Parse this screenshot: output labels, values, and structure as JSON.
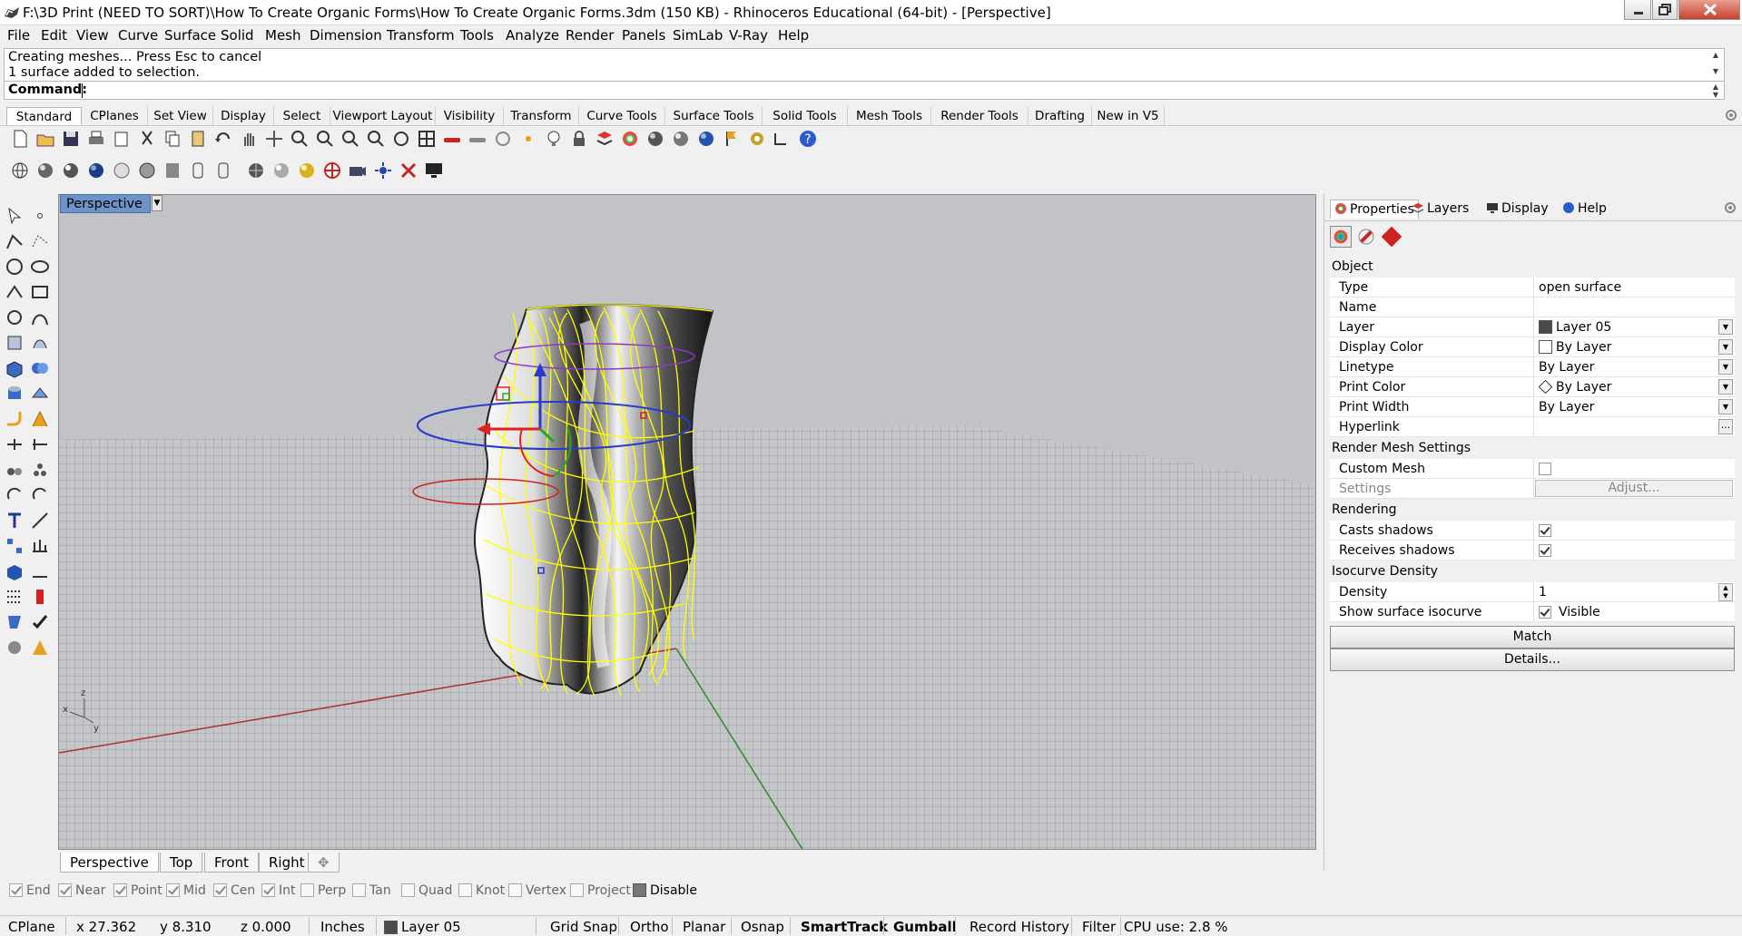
{
  "window": {
    "title": "F:\\3D Print (NEED TO SORT)\\How To Create Organic Forms\\How To Create Organic Forms.3dm (150 KB) - Rhinoceros Educational (64-bit) - [Perspective]"
  },
  "menu": [
    "File",
    "Edit",
    "View",
    "Curve",
    "Surface",
    "Solid",
    "Mesh",
    "Dimension",
    "Transform",
    "Tools",
    "Analyze",
    "Render",
    "Panels",
    "SimLab",
    "V-Ray",
    "Help"
  ],
  "command": {
    "history": [
      "Creating meshes... Press Esc to cancel",
      "1 surface added to selection."
    ],
    "prompt_label": "Command:"
  },
  "toolbar_tabs": [
    "Standard",
    "CPlanes",
    "Set View",
    "Display",
    "Select",
    "Viewport Layout",
    "Visibility",
    "Transform",
    "Curve Tools",
    "Surface Tools",
    "Solid Tools",
    "Mesh Tools",
    "Render Tools",
    "Drafting",
    "New in V5"
  ],
  "viewport": {
    "label": "Perspective",
    "axes": {
      "z": "z",
      "x": "x",
      "y": "y"
    }
  },
  "viewport_tabs": [
    "Perspective",
    "Top",
    "Front",
    "Right"
  ],
  "osnaps": [
    {
      "label": "End",
      "checked": true
    },
    {
      "label": "Near",
      "checked": true
    },
    {
      "label": "Point",
      "checked": true
    },
    {
      "label": "Mid",
      "checked": true
    },
    {
      "label": "Cen",
      "checked": true
    },
    {
      "label": "Int",
      "checked": true
    },
    {
      "label": "Perp",
      "checked": false
    },
    {
      "label": "Tan",
      "checked": false
    },
    {
      "label": "Quad",
      "checked": false
    },
    {
      "label": "Knot",
      "checked": false
    },
    {
      "label": "Vertex",
      "checked": false
    },
    {
      "label": "Project",
      "checked": false
    }
  ],
  "osnap_disable": "Disable",
  "status": {
    "cplane": "CPlane",
    "x": "x 27.362",
    "y": "y 8.310",
    "z": "z 0.000",
    "units": "Inches",
    "layer": "Layer 05",
    "grid_snap": "Grid Snap",
    "ortho": "Ortho",
    "planar": "Planar",
    "osnap": "Osnap",
    "smarttrack": "SmartTrack",
    "gumball": "Gumball",
    "record_history": "Record History",
    "filter": "Filter",
    "cpu": "CPU use: 2.8 %"
  },
  "panel": {
    "tabs": [
      "Properties",
      "Layers",
      "Display",
      "Help"
    ],
    "section_object": "Object",
    "rows": [
      {
        "k": "Type",
        "v": "open surface"
      },
      {
        "k": "Name",
        "v": ""
      },
      {
        "k": "Layer",
        "v": "Layer 05"
      },
      {
        "k": "Display Color",
        "v": "By Layer"
      },
      {
        "k": "Linetype",
        "v": "By Layer"
      },
      {
        "k": "Print Color",
        "v": "By Layer"
      },
      {
        "k": "Print Width",
        "v": "By Layer"
      },
      {
        "k": "Hyperlink",
        "v": ""
      }
    ],
    "hyperlink_button": "...",
    "section_render_mesh": "Render Mesh Settings",
    "custom_mesh": "Custom Mesh",
    "settings": "Settings",
    "adjust": "Adjust...",
    "section_rendering": "Rendering",
    "casts_shadows": "Casts shadows",
    "receives_shadows": "Receives shadows",
    "section_isocurve": "Isocurve Density",
    "density": "Density",
    "density_value": "1",
    "show_iso": "Show surface isocurve",
    "visible": "Visible",
    "match": "Match",
    "details": "Details..."
  },
  "colors": {
    "viewport_bg": "#a9abae",
    "selection": "#ffff00",
    "viewport_tab_active": "#6d93c9",
    "layer_swatch": "#4a4a4a"
  }
}
